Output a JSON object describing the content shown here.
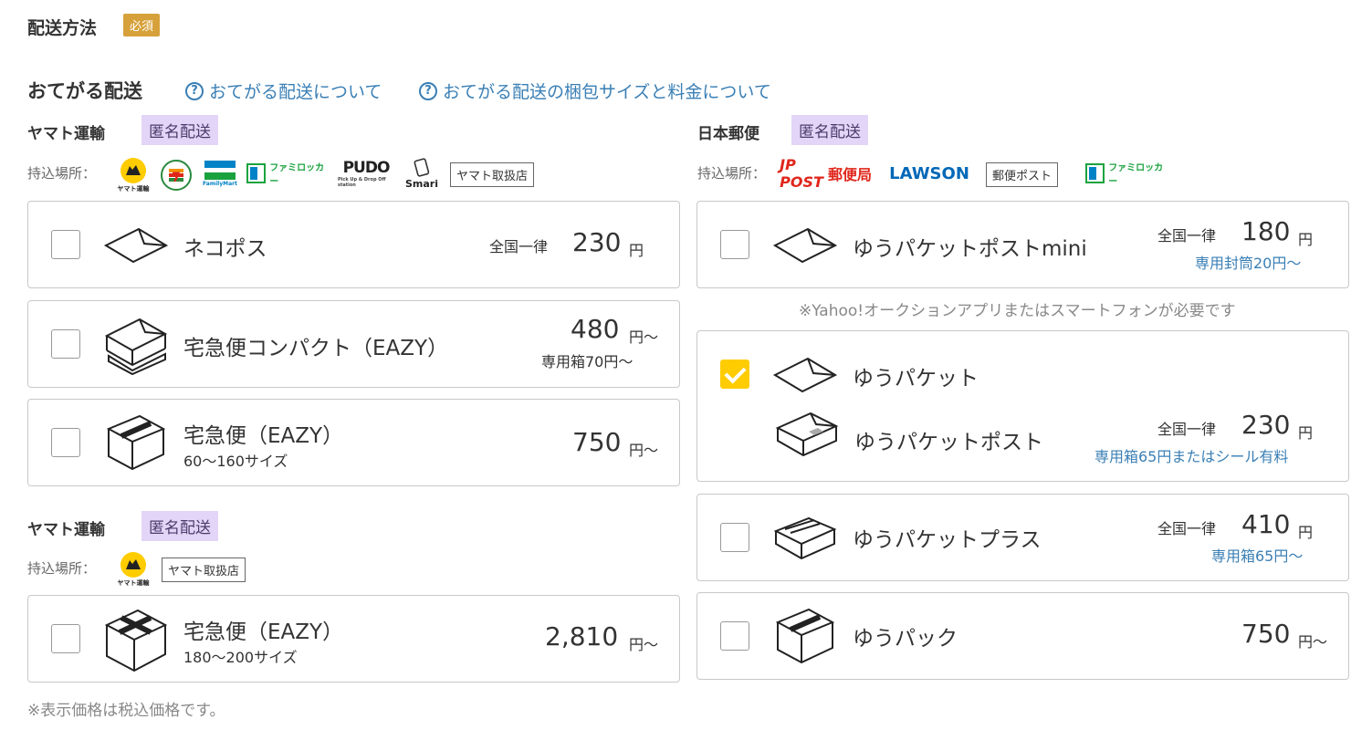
{
  "header": {
    "title": "配送方法",
    "required_badge": "必須"
  },
  "otegaru": {
    "title": "おてがる配送",
    "help_link_1": "おてがる配送について",
    "help_link_2": "おてがる配送の梱包サイズと料金について",
    "help_icon": "question-circle-icon"
  },
  "yamato_1": {
    "carrier": "ヤマト運輸",
    "anon_badge": "匿名配送",
    "dropoff_label": "持込場所：",
    "logos": [
      "ヤマト運輸",
      "7",
      "FamilyMart",
      "ファミロッカー",
      "PUDO",
      "Smari"
    ],
    "tag": "ヤマト取扱店"
  },
  "yamato_2": {
    "carrier": "ヤマト運輸",
    "anon_badge": "匿名配送",
    "dropoff_label": "持込場所：",
    "logos": [
      "ヤマト運輸"
    ],
    "tag": "ヤマト取扱店"
  },
  "japanpost": {
    "carrier": "日本郵便",
    "anon_badge": "匿名配送",
    "dropoff_label": "持込場所：",
    "logos": [
      "JP POST",
      "郵便局",
      "LAWSON",
      "ファミロッカー"
    ],
    "tag": "郵便ポスト"
  },
  "options_left": [
    {
      "name": "ネコポス",
      "flat": "全国一律",
      "price": "230",
      "yen": "円",
      "checked": false
    },
    {
      "name": "宅急便コンパクト（EAZY）",
      "price": "480",
      "yen": "円～",
      "note": "専用箱70円～",
      "checked": false
    },
    {
      "name": "宅急便（EAZY）",
      "sub": "60～160サイズ",
      "price": "750",
      "yen": "円～",
      "checked": false
    },
    {
      "name": "宅急便（EAZY）",
      "sub": "180～200サイズ",
      "price": "2,810",
      "yen": "円～",
      "checked": false
    }
  ],
  "options_right": [
    {
      "name": "ゆうパケットポストmini",
      "flat": "全国一律",
      "price": "180",
      "yen": "円",
      "note": "専用封筒20円～",
      "checked": false
    },
    {
      "name": "ゆうパケット",
      "name2": "ゆうパケットポスト",
      "flat": "全国一律",
      "price": "230",
      "yen": "円",
      "note": "専用箱65円またはシール有料",
      "checked": true
    },
    {
      "name": "ゆうパケットプラス",
      "flat": "全国一律",
      "price": "410",
      "yen": "円",
      "note": "専用箱65円～",
      "checked": false
    },
    {
      "name": "ゆうパック",
      "price": "750",
      "yen": "円～",
      "checked": false
    }
  ],
  "app_note": "※Yahoo!オークションアプリまたはスマートフォンが必要です",
  "tax_note": "※表示価格は税込価格です。",
  "colors": {
    "accent_link": "#3a7fb5",
    "badge_required": "#d6a13a",
    "badge_anon": "#e3d5f7",
    "checkbox_checked": "#ffcc00"
  }
}
